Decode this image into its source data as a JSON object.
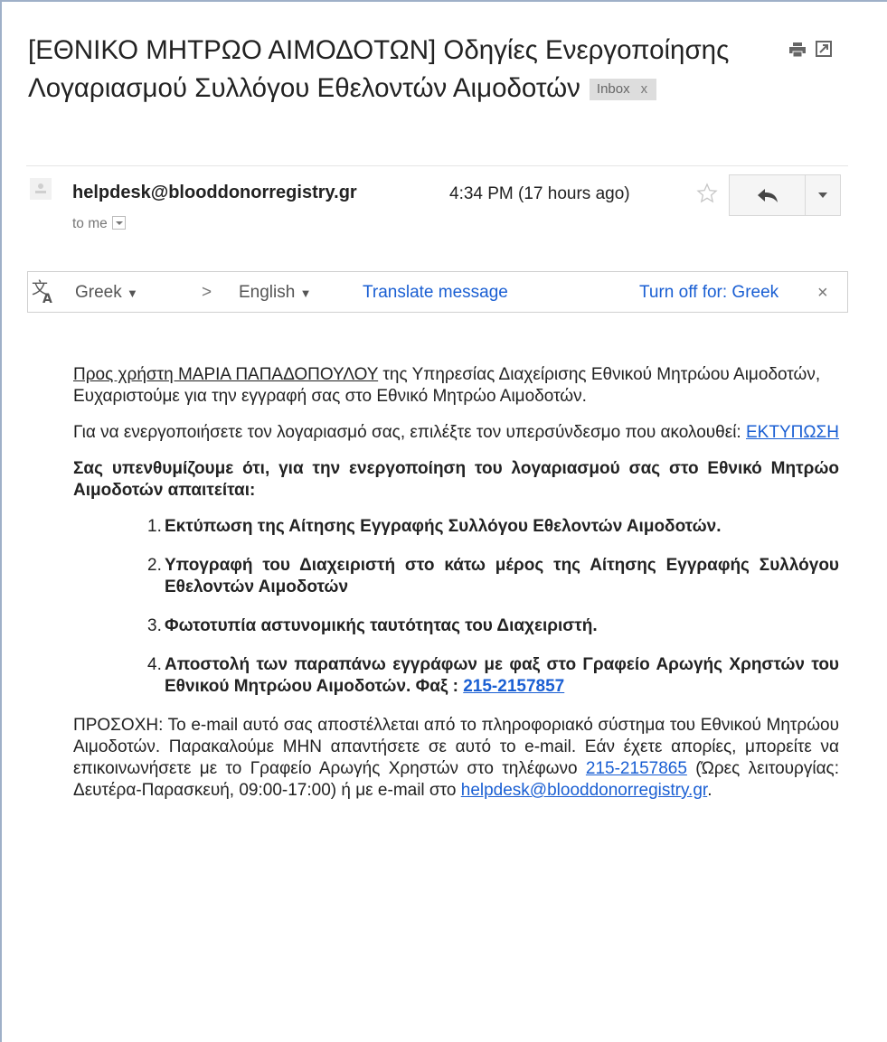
{
  "email": {
    "subject": "[ΕΘΝΙΚΟ ΜΗΤΡΩΟ ΑΙΜΟΔΟΤΩΝ] Οδηγίες Ενεργοποίησης Λογαριασμού Συλλόγου Εθελοντών Αιμοδοτών",
    "label": "Inbox",
    "label_close": "x",
    "sender": "helpdesk@blooddonorregistry.gr",
    "recipient_line": "to me",
    "time": "4:34 PM (17 hours ago)"
  },
  "icons": {
    "print": "print-icon",
    "new_window": "new-window-icon",
    "star": "star-icon",
    "reply": "reply-icon",
    "more": "chevron-down-icon",
    "translate": "translate-icon",
    "avatar": "avatar-placeholder"
  },
  "translate_bar": {
    "source_language": "Greek",
    "arrow": ">",
    "target_language": "English",
    "action": "Translate message",
    "turn_off": "Turn off for: Greek",
    "close": "×"
  },
  "body": {
    "greeting_link": "Προς χρήστη ΜΑΡΙΑ ΠΑΠΑΔΟΠΟΥΛΟΥ",
    "greeting_rest": " της Υπηρεσίας Διαχείρισης Εθνικού Μητρώου Αιμοδοτών, Ευχαριστούμε για την εγγραφή σας στο Εθνικό Μητρώο Αιμοδοτών.",
    "activate_text": "Για να ενεργοποιήσετε τον λογαριασμό σας, επιλέξτε τον υπερσύνδεσμο που ακολουθεί: ",
    "activate_link": "ΕΚΤΥΠΩΣΗ",
    "reminder": "Σας υπενθυμίζουμε ότι, για την ενεργοποίηση του λογαριασμού σας στο Εθνικό Μητρώο Αιμοδοτών απαιτείται:",
    "steps": [
      {
        "num": "1.",
        "text": "Εκτύπωση της Αίτησης Εγγραφής Συλλόγου Εθελοντών Αιμοδοτών."
      },
      {
        "num": "2.",
        "text": "Υπογραφή του Διαχειριστή στο κάτω μέρος της Αίτησης Εγγραφής Συλλόγου Εθελοντών Αιμοδοτών"
      },
      {
        "num": "3.",
        "text": "Φωτοτυπία αστυνομικής ταυτότητας του Διαχειριστή."
      },
      {
        "num": "4.",
        "text": "Αποστολή των παραπάνω εγγράφων με φαξ στο Γραφείο Αρωγής Χρηστών του Εθνικού Μητρώου Αιμοδοτών. Φαξ : ",
        "link": "215-2157857"
      }
    ],
    "notice_part1": "ΠΡΟΣΟΧΗ: Το e-mail αυτό σας αποστέλλεται από το πληροφοριακό σύστημα του Εθνικού Μητρώου Αιμοδοτών. Παρακαλούμε ΜΗΝ απαντήσετε σε αυτό το e-mail. Εάν έχετε απορίες, μπορείτε να επικοινωνήσετε με το Γραφείο Αρωγής Χρηστών στο τηλέφωνο ",
    "notice_phone": "215-2157865",
    "notice_part2": " (Ώρες λειτουργίας: Δευτέρα-Παρασκευή, 09:00-17:00) ή με e-mail στο ",
    "notice_email": "helpdesk@blooddonorregistry.gr",
    "notice_end": "."
  },
  "colors": {
    "link": "#1a5fd3",
    "label_bg": "#dddddd",
    "border": "#d0d0d0"
  }
}
